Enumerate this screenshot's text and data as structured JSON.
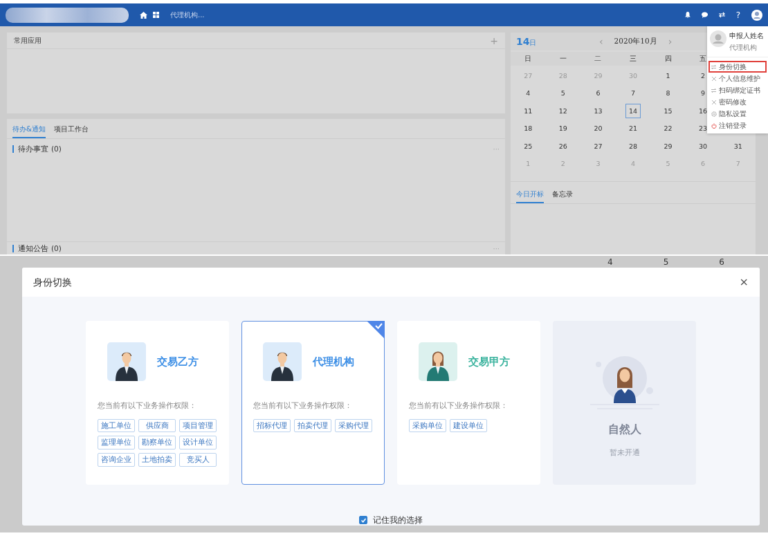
{
  "top_bar": {
    "breadcrumb": "代理机构...",
    "help": "?"
  },
  "apps_panel": {
    "title": "常用应用",
    "add": "+"
  },
  "work_panel": {
    "tabs": [
      {
        "label": "待办&通知",
        "selected": true
      },
      {
        "label": "项目工作台",
        "selected": false
      }
    ],
    "sections": [
      {
        "title": "待办事宜",
        "count": "(0)",
        "more": "···"
      },
      {
        "title": "通知公告",
        "count": "(0)",
        "more": "···"
      }
    ]
  },
  "calendar": {
    "day": "14",
    "day_suffix": "日",
    "month": "2020年10月",
    "prev": "‹",
    "next": "›",
    "weekdays": [
      "日",
      "一",
      "二",
      "三",
      "四",
      "五"
    ],
    "weeks": [
      [
        {
          "day": "27",
          "muted": true,
          "selected": false
        },
        {
          "day": "28",
          "muted": true,
          "selected": false
        },
        {
          "day": "29",
          "muted": true,
          "selected": false
        },
        {
          "day": "30",
          "muted": true,
          "selected": false
        },
        {
          "day": "1",
          "muted": false,
          "selected": false
        },
        {
          "day": "2",
          "muted": false,
          "selected": false
        }
      ],
      [
        {
          "day": "4",
          "muted": false,
          "selected": false
        },
        {
          "day": "5",
          "muted": false,
          "selected": false
        },
        {
          "day": "6",
          "muted": false,
          "selected": false
        },
        {
          "day": "7",
          "muted": false,
          "selected": false
        },
        {
          "day": "8",
          "muted": false,
          "selected": false
        },
        {
          "day": "9",
          "muted": false,
          "selected": false
        }
      ],
      [
        {
          "day": "11",
          "muted": false,
          "selected": false
        },
        {
          "day": "12",
          "muted": false,
          "selected": false
        },
        {
          "day": "13",
          "muted": false,
          "selected": false
        },
        {
          "day": "14",
          "muted": false,
          "selected": true
        },
        {
          "day": "15",
          "muted": false,
          "selected": false
        },
        {
          "day": "16",
          "muted": false,
          "selected": false
        }
      ],
      [
        {
          "day": "18",
          "muted": false,
          "selected": false
        },
        {
          "day": "19",
          "muted": false,
          "selected": false
        },
        {
          "day": "20",
          "muted": false,
          "selected": false
        },
        {
          "day": "21",
          "muted": false,
          "selected": false
        },
        {
          "day": "22",
          "muted": false,
          "selected": false
        },
        {
          "day": "23",
          "muted": false,
          "selected": false
        }
      ],
      [
        {
          "day": "25",
          "muted": false,
          "selected": false
        },
        {
          "day": "26",
          "muted": false,
          "selected": false
        },
        {
          "day": "27",
          "muted": false,
          "selected": false
        },
        {
          "day": "28",
          "muted": false,
          "selected": false
        },
        {
          "day": "29",
          "muted": false,
          "selected": false
        },
        {
          "day": "30",
          "muted": false,
          "selected": false
        },
        {
          "day": "31",
          "muted": false,
          "selected": false
        }
      ],
      [
        {
          "day": "1",
          "muted": true,
          "selected": false
        },
        {
          "day": "2",
          "muted": true,
          "selected": false
        },
        {
          "day": "3",
          "muted": true,
          "selected": false
        },
        {
          "day": "4",
          "muted": true,
          "selected": false
        },
        {
          "day": "5",
          "muted": true,
          "selected": false
        },
        {
          "day": "6",
          "muted": true,
          "selected": false
        },
        {
          "day": "7",
          "muted": true,
          "selected": false
        }
      ]
    ],
    "tabs": [
      {
        "label": "今日开标",
        "selected": true
      },
      {
        "label": "备忘录",
        "selected": false
      }
    ]
  },
  "user_menu": {
    "name": "申报人姓名",
    "org": "代理机构",
    "items": [
      {
        "kind": "swap",
        "label": "身份切换",
        "highlighted": true
      },
      {
        "kind": "tools",
        "label": "个人信息维护",
        "highlighted": false
      },
      {
        "kind": "swap",
        "label": "扫码绑定证书",
        "highlighted": false
      },
      {
        "kind": "tools",
        "label": "密码修改",
        "highlighted": false
      },
      {
        "kind": "gear",
        "label": "隐私设置",
        "highlighted": false
      },
      {
        "kind": "power",
        "label": "注销登录",
        "highlighted": false
      }
    ]
  },
  "background_fragment": [
    "4",
    "5",
    "6"
  ],
  "dialog": {
    "title": "身份切换",
    "close": "×",
    "roles": [
      {
        "kind": "role",
        "avatar": {
          "kind": "man"
        },
        "title": "交易乙方",
        "color": "#3d8fe6",
        "description": "您当前有以下业务操作权限：",
        "tags": [
          "施工单位",
          "供应商",
          "项目管理",
          "监理单位",
          "勘察单位",
          "设计单位",
          "咨询企业",
          "土地拍卖",
          "竞买人"
        ],
        "selected": false
      },
      {
        "kind": "role",
        "avatar": {
          "kind": "man"
        },
        "title": "代理机构",
        "color": "#3d8fe6",
        "description": "您当前有以下业务操作权限：",
        "tags": [
          "招标代理",
          "拍卖代理",
          "采购代理"
        ],
        "selected": true
      },
      {
        "kind": "role",
        "avatar": {
          "kind": "woman"
        },
        "title": "交易甲方",
        "color": "#3bb39e",
        "description": "您当前有以下业务操作权限：",
        "tags": [
          "采购单位",
          "建设单位"
        ],
        "selected": false
      },
      {
        "kind": "unavailable",
        "avatar": {
          "kind": "woman"
        },
        "title": "自然人",
        "note": "暂未开通"
      }
    ],
    "remember": {
      "label": "记住我的选择",
      "checked": true
    }
  }
}
